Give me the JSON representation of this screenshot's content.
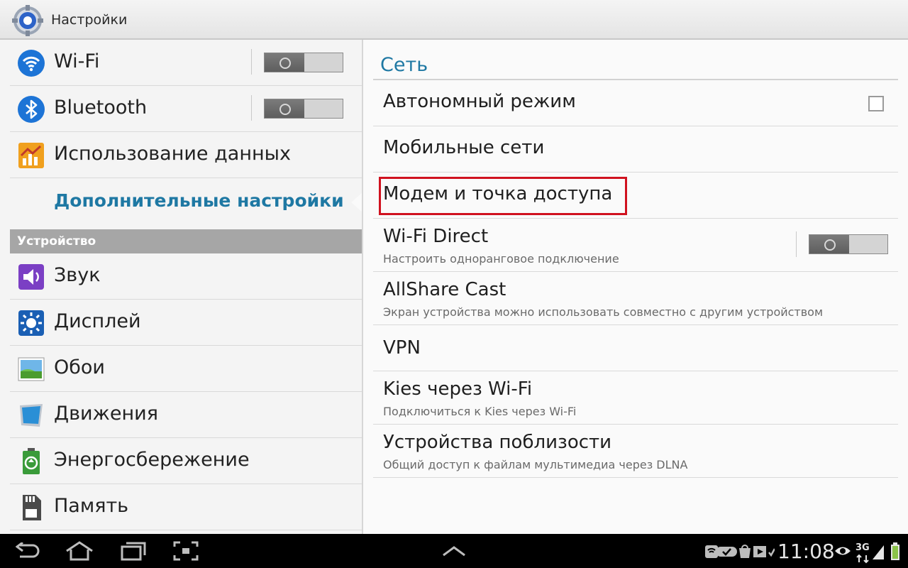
{
  "app": {
    "title": "Настройки"
  },
  "left": {
    "items_top": [
      {
        "label": "Wi-Fi",
        "icon": "wifi-icon",
        "toggle": "off"
      },
      {
        "label": "Bluetooth",
        "icon": "bluetooth-icon",
        "toggle": "off"
      },
      {
        "label": "Использование данных",
        "icon": "data-usage-icon"
      },
      {
        "label": "Дополнительные настройки",
        "selected": true
      }
    ],
    "section_label": "Устройство",
    "items_device": [
      {
        "label": "Звук",
        "icon": "sound-icon"
      },
      {
        "label": "Дисплей",
        "icon": "display-icon"
      },
      {
        "label": "Обои",
        "icon": "wallpaper-icon"
      },
      {
        "label": "Движения",
        "icon": "motion-icon"
      },
      {
        "label": "Энергосбережение",
        "icon": "power-saving-icon"
      },
      {
        "label": "Память",
        "icon": "storage-icon"
      }
    ]
  },
  "right": {
    "title": "Сеть",
    "items": [
      {
        "title": "Автономный режим",
        "control": "checkbox",
        "checked": false
      },
      {
        "title": "Мобильные сети"
      },
      {
        "title": "Модем и точка доступа",
        "highlighted": true
      },
      {
        "title": "Wi-Fi Direct",
        "subtitle": "Настроить одноранговое подключение",
        "toggle": "off"
      },
      {
        "title": "AllShare Cast",
        "subtitle": "Экран устройства можно использовать совместно с другим устройством"
      },
      {
        "title": "VPN"
      },
      {
        "title": "Kies через Wi-Fi",
        "subtitle": "Подключиться к Kies через Wi-Fi"
      },
      {
        "title": "Устройства поблизости",
        "subtitle": "Общий доступ к файлам мультимедиа через DLNA"
      }
    ]
  },
  "sysbar": {
    "time": "11:08",
    "network": "3G",
    "colors": {
      "accent": "#1e78a3",
      "highlight": "#d0121f"
    }
  }
}
